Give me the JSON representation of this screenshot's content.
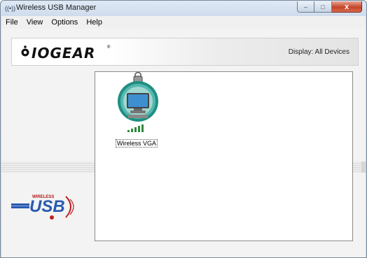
{
  "window": {
    "title": "Wireless USB Manager"
  },
  "title_controls": {
    "minimize": "–",
    "maximize": "□",
    "close": "x"
  },
  "menu": [
    "File",
    "View",
    "Options",
    "Help"
  ],
  "header": {
    "brand": "IOGEAR",
    "display_label": "Display:  All Devices"
  },
  "left_panel": {
    "usb_logo": "USB"
  },
  "devices": [
    {
      "label": "Wireless VGA",
      "icon": "monitor-icon"
    }
  ],
  "colors": {
    "accent_teal": "#1f8f82",
    "screen_blue": "#3e8fd0",
    "usb_blue": "#2a5ab0"
  }
}
